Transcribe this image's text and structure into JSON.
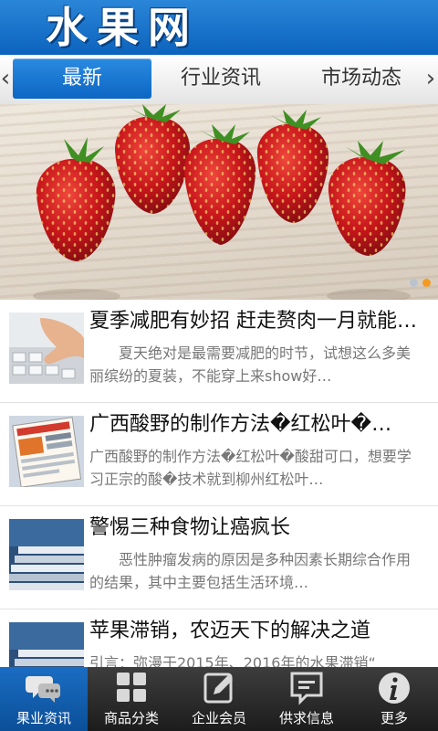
{
  "header": {
    "title": "水果网"
  },
  "tabs": {
    "items": [
      {
        "label": "最新",
        "active": true
      },
      {
        "label": "行业资讯",
        "active": false
      },
      {
        "label": "市场动态",
        "active": false
      }
    ],
    "prev_arrow": "‹",
    "next_arrow": "›"
  },
  "banner": {
    "subject": "strawberries",
    "slide_count": 2,
    "active_slide": 2
  },
  "news": [
    {
      "title": "夏季减肥有妙招 赶走赘肉一月就能…",
      "summary": "　　夏天绝对是最需要减肥的时节，试想这么多美丽缤纷的夏装，不能穿上来show好…",
      "thumb": "hand-on-keyboard"
    },
    {
      "title": " 广西酸野的制作方法�红松叶�…",
      "summary": "广西酸野的制作方法�红松叶�酸甜可口，想要学习正宗的酸�技术就到柳州红松叶…",
      "thumb": "magazine-pages"
    },
    {
      "title": "警惕三种食物让癌疯长",
      "summary": "　　恶性肿瘤发病的原因是多种因素长期综合作用的结果，其中主要包括生活环境…",
      "thumb": "stacked-books"
    },
    {
      "title": "苹果滞销，农迈天下的解决之道",
      "summary": "引言：弥漫于2015年、2016年的水果滞销“",
      "thumb": "stacked-books"
    }
  ],
  "bottom_nav": [
    {
      "label": "果业资讯",
      "icon": "chat-bubbles-icon",
      "active": true
    },
    {
      "label": "商品分类",
      "icon": "grid-icon",
      "active": false
    },
    {
      "label": "企业会员",
      "icon": "edit-icon",
      "active": false
    },
    {
      "label": "供求信息",
      "icon": "message-icon",
      "active": false
    },
    {
      "label": "更多",
      "icon": "info-icon",
      "active": false
    }
  ],
  "colors": {
    "header_blue": "#0c63bd",
    "active_tab": "#1a75d2",
    "nav_active": "#1560b3",
    "dot_active": "#f39a1f"
  }
}
